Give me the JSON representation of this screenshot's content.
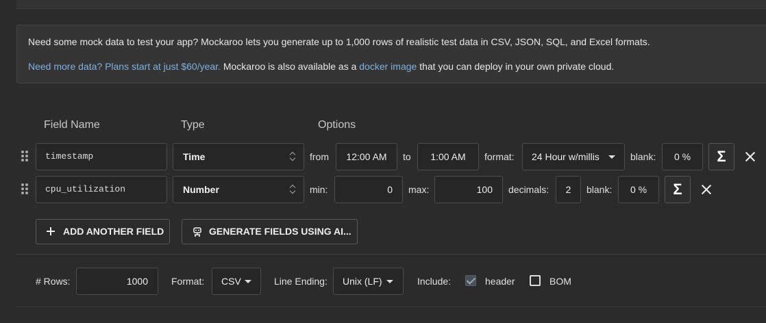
{
  "info": {
    "line1": "Need some mock data to test your app? Mockaroo lets you generate up to 1,000 rows of realistic test data in CSV, JSON, SQL, and Excel formats.",
    "plans_link": "Need more data? Plans start at just $60/year.",
    "line2_mid": " Mockaroo is also available as a ",
    "docker_link": "docker image",
    "line2_end": " that you can deploy in your own private cloud."
  },
  "headers": {
    "field_name": "Field Name",
    "type": "Type",
    "options": "Options"
  },
  "fields": [
    {
      "name": "timestamp",
      "type": "Time",
      "from_label": "from",
      "from_value": "12:00 AM",
      "to_label": "to",
      "to_value": "1:00 AM",
      "format_label": "format:",
      "format_value": "24 Hour w/millis",
      "blank_label": "blank:",
      "blank_value": "0 %"
    },
    {
      "name": "cpu_utilization",
      "type": "Number",
      "min_label": "min:",
      "min_value": "0",
      "max_label": "max:",
      "max_value": "100",
      "decimals_label": "decimals:",
      "decimals_value": "2",
      "blank_label": "blank:",
      "blank_value": "0 %"
    }
  ],
  "sigma_symbol": "Σ",
  "buttons": {
    "add_field": "ADD ANOTHER FIELD",
    "generate_ai": "GENERATE FIELDS USING AI..."
  },
  "footer": {
    "rows_label": "# Rows:",
    "rows_value": "1000",
    "format_label": "Format:",
    "format_value": "CSV",
    "line_ending_label": "Line Ending:",
    "line_ending_value": "Unix (LF)",
    "include_label": "Include:",
    "header_label": "header",
    "header_checked": true,
    "bom_label": "BOM",
    "bom_checked": false
  },
  "colors": {
    "background": "#2b2b2b",
    "link": "#7fb1e0",
    "panel": "#353535"
  }
}
